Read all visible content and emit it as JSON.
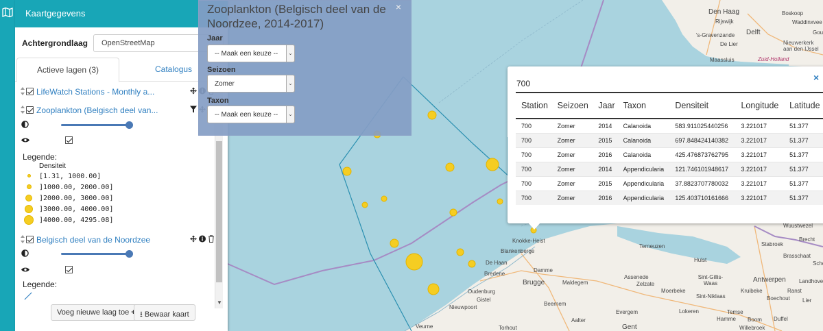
{
  "panel": {
    "title": "Kaartgegevens",
    "basemap_label": "Achtergrondlaag",
    "basemap_value": "OpenStreetMap",
    "tabs": [
      {
        "label": "Actieve lagen (3)",
        "active": true
      },
      {
        "label": "Catalogus",
        "active": false
      }
    ],
    "layers": [
      {
        "name": "LifeWatch Stations - Monthly a...",
        "checked": true
      },
      {
        "name": "Zooplankton (Belgisch deel van...",
        "checked": true,
        "legend_title": "Legende:",
        "legend_subtitle": "Densiteit",
        "legend_items": [
          {
            "label": "[1.31, 1000.00]"
          },
          {
            "label": "]1000.00, 2000.00]"
          },
          {
            "label": "]2000.00, 3000.00]"
          },
          {
            "label": "]3000.00, 4000.00]"
          },
          {
            "label": "]4000.00, 4295.08]"
          }
        ]
      },
      {
        "name": "Belgisch deel van de Noordzee",
        "checked": true,
        "legend_title": "Legende:"
      }
    ],
    "add_layer_button": "Voeg nieuwe laag toe",
    "save_map_button": "Bewaar kaart",
    "colors": {
      "header": "#18a6b7",
      "link": "#2f7fc0",
      "slider": "#4a79b5"
    }
  },
  "filter": {
    "title": "Zooplankton (Belgisch deel van de Noordzee, 2014-2017)",
    "close": "×",
    "fields": [
      {
        "label": "Jaar",
        "value": "-- Maak een keuze --"
      },
      {
        "label": "Seizoen",
        "value": "Zomer"
      },
      {
        "label": "Taxon",
        "value": "-- Maak een keuze --"
      }
    ]
  },
  "popup": {
    "close": "×",
    "heading": "700",
    "columns": [
      "Station",
      "Seizoen",
      "Jaar",
      "Taxon",
      "Densiteit",
      "Longitude",
      "Latitude"
    ],
    "rows": [
      [
        "700",
        "Zomer",
        "2014",
        "Calanoida",
        "583.911025440256",
        "3.221017",
        "51.377"
      ],
      [
        "700",
        "Zomer",
        "2015",
        "Calanoida",
        "697.848424140382",
        "3.221017",
        "51.377"
      ],
      [
        "700",
        "Zomer",
        "2016",
        "Calanoida",
        "425.476873762795",
        "3.221017",
        "51.377"
      ],
      [
        "700",
        "Zomer",
        "2014",
        "Appendicularia",
        "121.746101948617",
        "3.221017",
        "51.377"
      ],
      [
        "700",
        "Zomer",
        "2015",
        "Appendicularia",
        "37.8823707780032",
        "3.221017",
        "51.377"
      ],
      [
        "700",
        "Zomer",
        "2016",
        "Appendicularia",
        "125.403710161666",
        "3.221017",
        "51.377"
      ]
    ]
  },
  "map": {
    "colors": {
      "sea": "#a9d3df",
      "land": "#f2efe9",
      "marker": "#f5cd22",
      "eez": "#a68bc4",
      "station_line": "#2a8fb0"
    },
    "labels": [
      "Den Haag",
      "Boskoop",
      "Rijswijk",
      "Waddinxvee",
      "Delft",
      "'s-Gravenzande",
      "Gou",
      "De Lier",
      "Nieuwerkerk aan den IJssel",
      "Maassluis",
      "Zuid-Holland",
      "Wuustwezel",
      "Brecht",
      "Stabroek",
      "Brasschaat",
      "Schote",
      "Knokke-Heist",
      "Blankenberge",
      "Terneuzen",
      "Hulst",
      "De Haan",
      "Bredene",
      "Damme",
      "Assenede",
      "Zelzate",
      "Sint-Gillis-Waas",
      "Antwerpen",
      "Landhove",
      "Brugge",
      "Maldegem",
      "Moerbeke",
      "Sint-Niklaas",
      "Kruibeke",
      "Ranst",
      "Boechout",
      "Lier",
      "Oudenburg",
      "Gistel",
      "Beernem",
      "Evergem",
      "Lokeren",
      "Temse",
      "Nieuwpoort",
      "Aalter",
      "Hamme",
      "Boom",
      "Duffel",
      "Veurne",
      "Torhout",
      "Gent",
      "Willebroek"
    ]
  }
}
